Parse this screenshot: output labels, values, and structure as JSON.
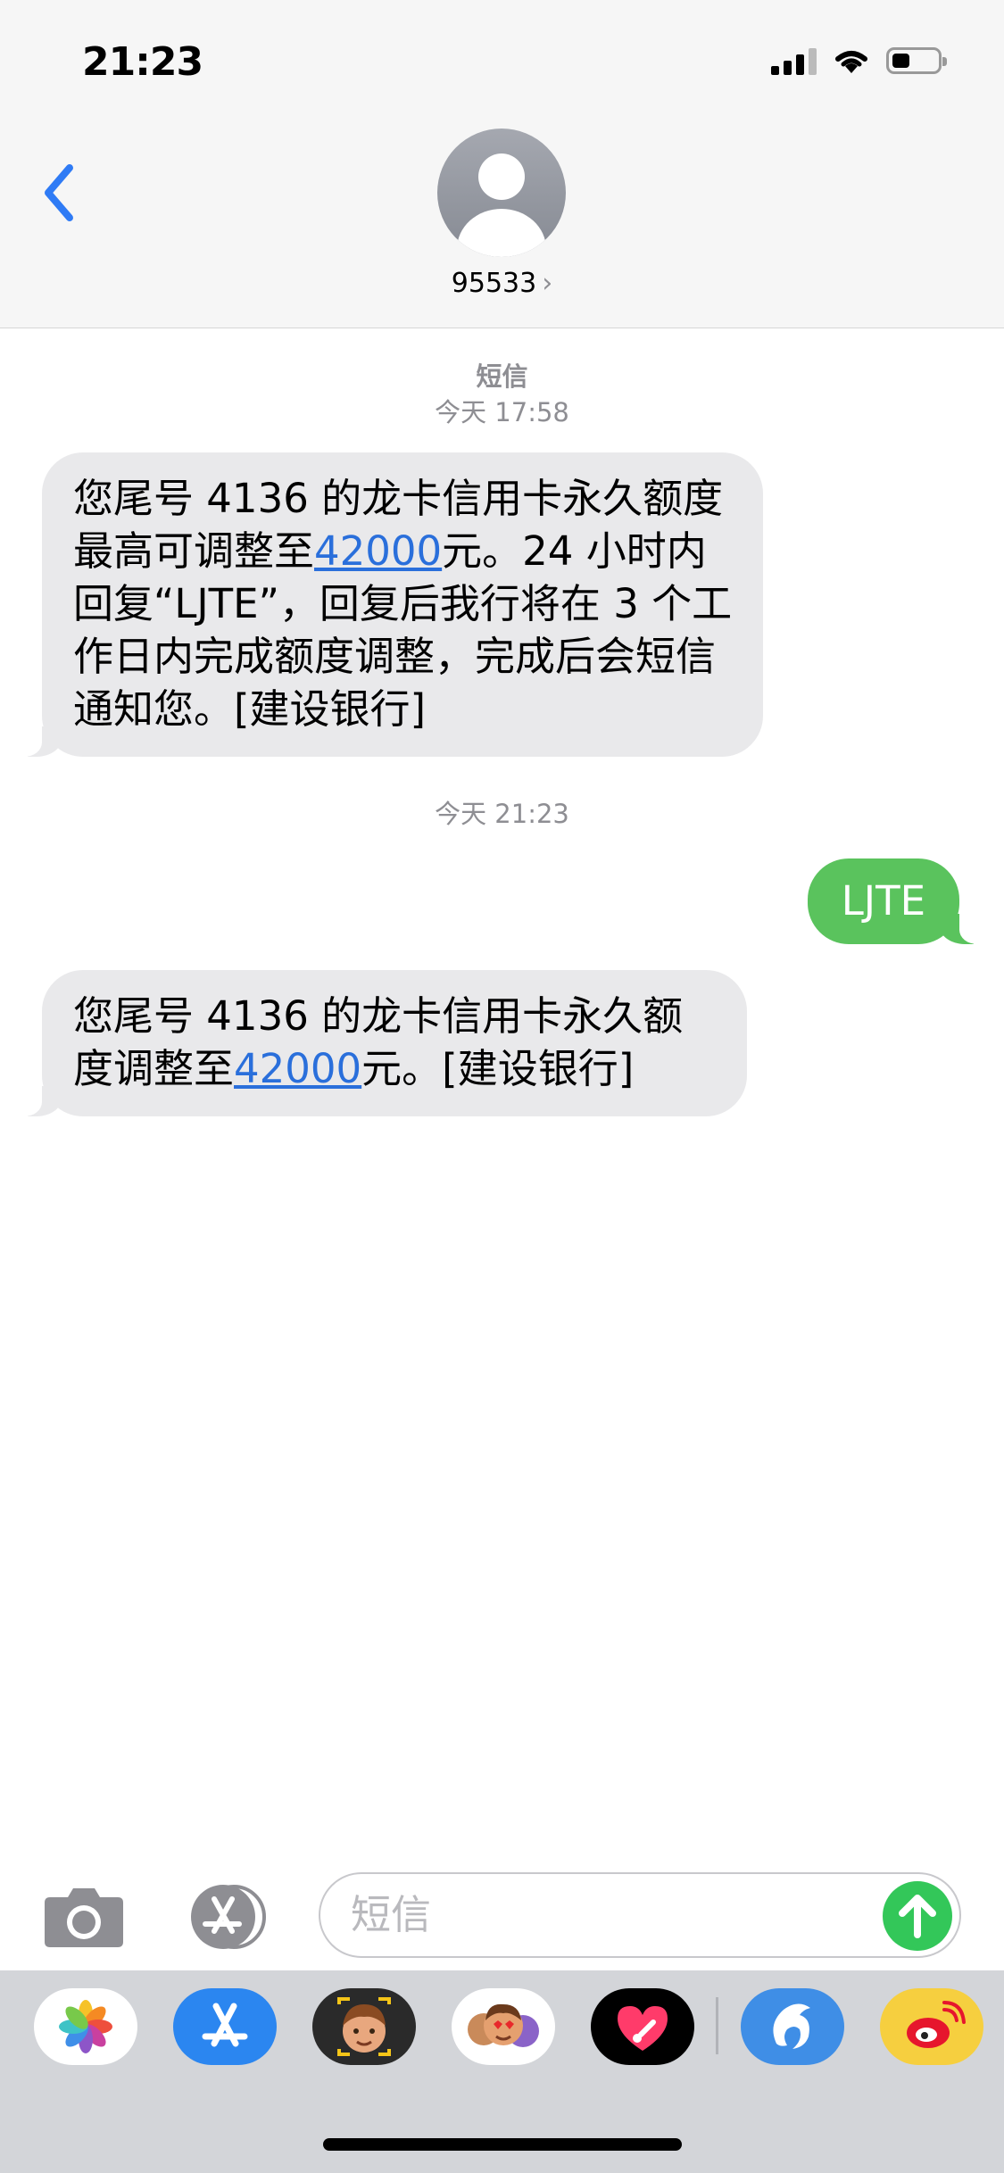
{
  "status_bar": {
    "time": "21:23",
    "battery_level": 0.35
  },
  "header": {
    "contact_number": "95533",
    "contact_chevron": "›"
  },
  "conversation": {
    "service_label": "短信",
    "timestamp_1": "今天 17:58",
    "msg1": {
      "part1": "您尾号 4136 的龙卡信用卡永久额度最高可调整至",
      "amount": "42000",
      "part2": "元。24 小时内回复“LJTE”，回复后我行将在 3 个工作日内完成额度调整，完成后会短信通知您。[建设银行]"
    },
    "timestamp_2": "今天 21:23",
    "reply": "LJTE",
    "msg2": {
      "part1": "您尾号 4136 的龙卡信用卡永久额度调整至",
      "amount": "42000",
      "part2": "元。[建设银行]"
    }
  },
  "input_bar": {
    "placeholder": "短信"
  },
  "app_drawer": {
    "apps": [
      "photos-icon",
      "app-store-icon",
      "memoji-icon",
      "animoji-icon",
      "digital-touch-icon",
      "dolphin-app-icon",
      "weibo-icon"
    ]
  },
  "colors": {
    "accent": "#2a6fdb",
    "sent_bubble": "#5ac35d",
    "received_bubble": "#e9e9eb",
    "send_button": "#33c759"
  }
}
